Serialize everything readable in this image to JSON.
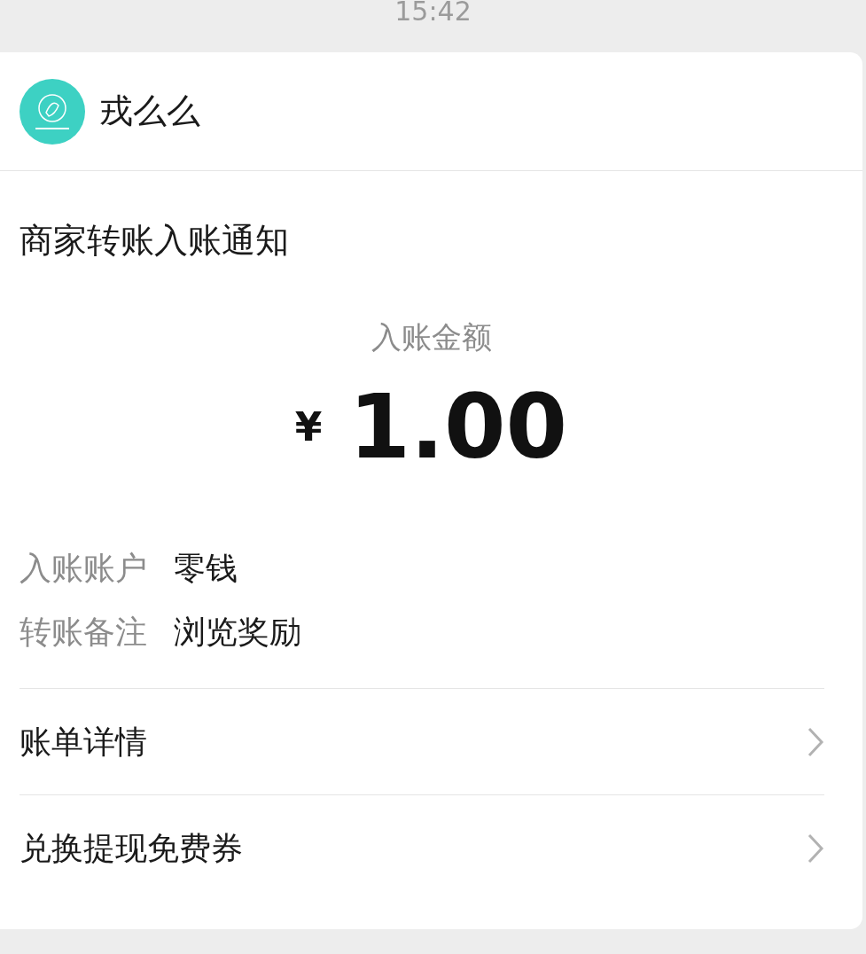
{
  "time": "15:42",
  "sender": {
    "name": "戎么么"
  },
  "title": "商家转账入账通知",
  "amount": {
    "label": "入账金额",
    "currency": "¥",
    "value": "1.00"
  },
  "details": [
    {
      "label": "入账账户",
      "value": "零钱"
    },
    {
      "label": "转账备注",
      "value": "浏览奖励"
    }
  ],
  "links": [
    {
      "label": "账单详情"
    },
    {
      "label": "兑换提现免费券"
    }
  ]
}
